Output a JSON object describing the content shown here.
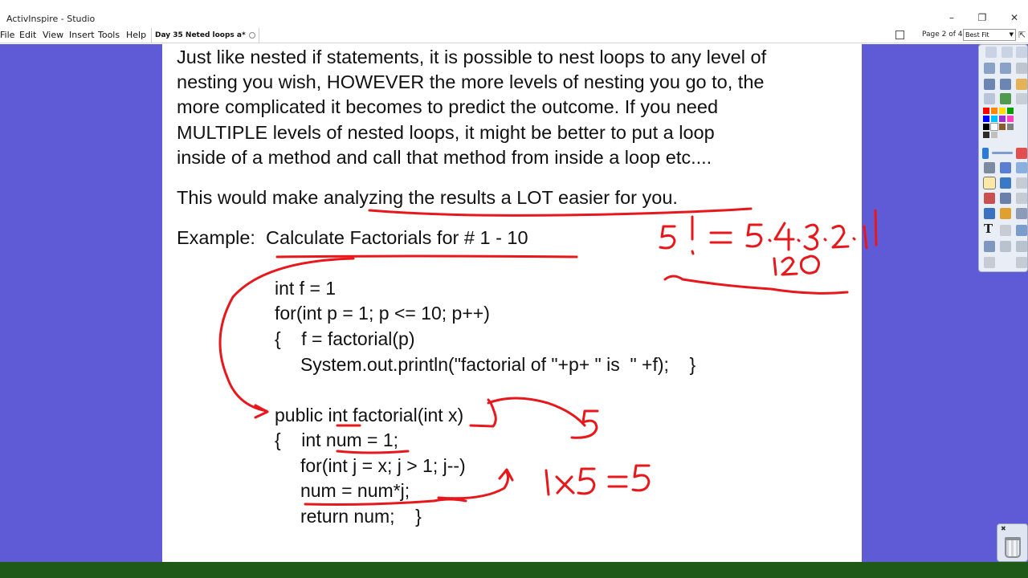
{
  "window": {
    "title": "ActivInspire - Studio",
    "controls": {
      "minimize": "–",
      "restore": "❐",
      "close": "✕"
    }
  },
  "menubar": {
    "items": [
      "File",
      "Edit",
      "View",
      "Insert",
      "Tools",
      "Help"
    ],
    "document_tab": "Day 35 Neted loops a*",
    "page_indicator": "Page 2 of 4",
    "zoom": "Best Fit"
  },
  "flipchart": {
    "paragraph1": [
      "Just like nested if statements, it is possible to nest loops to any level of",
      "nesting you wish, HOWEVER the more levels of nesting you go to, the",
      "more complicated it becomes to predict the outcome.  If you need",
      "MULTIPLE levels of nested loops, it might be better to put a loop",
      "inside of a method and call that method from inside a loop etc...."
    ],
    "paragraph2": "This would make analyzing the results a LOT easier for you.",
    "example_prefix": "Example:",
    "example_title": "Calculate Factorials for # 1 - 10",
    "code_main": [
      "int f = 1",
      "for(int p = 1; p <= 10; p++)",
      "{    f = factorial(p)",
      "     System.out.println(\"factorial of \"+p+ \" is  \" +f);    }"
    ],
    "code_method": [
      "public int factorial(int x)",
      "{    int num = 1;",
      "     for(int j = x; j > 1; j--)",
      "     num = num*j;",
      "     return num;    }"
    ],
    "annotation_factorial": "5! = 5·4·3·2·1",
    "annotation_result": "120",
    "annotation_x_value": "5",
    "annotation_product": "1x5 = 5"
  },
  "colors": {
    "canvas_background": "#5f5bd6",
    "ink": "#e8171b",
    "taskbar": "#1f5a19"
  }
}
